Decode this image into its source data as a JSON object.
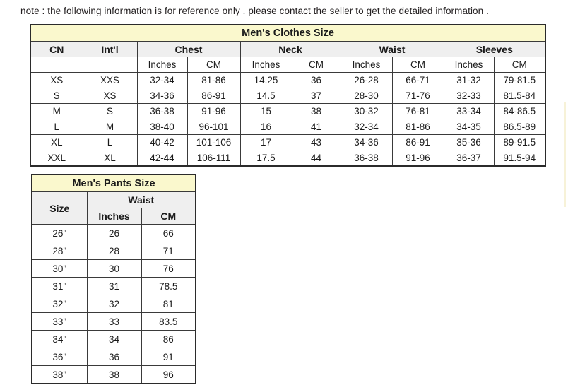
{
  "note": {
    "text": "note : the following information is for reference only . please contact the seller to get the detailed information ."
  },
  "colors": {
    "title_background": "#faf8cd",
    "header_background": "#efefef",
    "cell_background": "#ffffff",
    "border": "#3a3a3a",
    "outer_border": "#2b2b2b",
    "text": "#1b1b1b",
    "artifact_line": "#f7f2d8"
  },
  "clothes_table": {
    "title": "Men's Clothes Size",
    "group_headers": [
      "CN",
      "Int'l",
      "Chest",
      "Neck",
      "Waist",
      "Sleeves"
    ],
    "unit_headers": {
      "cn": "",
      "intl": "",
      "chest_inches": "Inches",
      "chest_cm": "CM",
      "neck_inches": "Inches",
      "neck_cm": "CM",
      "waist_inches": "Inches",
      "waist_cm": "CM",
      "sleeves_inches": "Inches",
      "sleeves_cm": "CM"
    },
    "rows": [
      {
        "cn": "XS",
        "intl": "XXS",
        "chest_inches": "32-34",
        "chest_cm": "81-86",
        "neck_inches": "14.25",
        "neck_cm": "36",
        "waist_inches": "26-28",
        "waist_cm": "66-71",
        "sleeves_inches": "31-32",
        "sleeves_cm": "79-81.5"
      },
      {
        "cn": "S",
        "intl": "XS",
        "chest_inches": "34-36",
        "chest_cm": "86-91",
        "neck_inches": "14.5",
        "neck_cm": "37",
        "waist_inches": "28-30",
        "waist_cm": "71-76",
        "sleeves_inches": "32-33",
        "sleeves_cm": "81.5-84"
      },
      {
        "cn": "M",
        "intl": "S",
        "chest_inches": "36-38",
        "chest_cm": "91-96",
        "neck_inches": "15",
        "neck_cm": "38",
        "waist_inches": "30-32",
        "waist_cm": "76-81",
        "sleeves_inches": "33-34",
        "sleeves_cm": "84-86.5"
      },
      {
        "cn": "L",
        "intl": "M",
        "chest_inches": "38-40",
        "chest_cm": "96-101",
        "neck_inches": "16",
        "neck_cm": "41",
        "waist_inches": "32-34",
        "waist_cm": "81-86",
        "sleeves_inches": "34-35",
        "sleeves_cm": "86.5-89"
      },
      {
        "cn": "XL",
        "intl": "L",
        "chest_inches": "40-42",
        "chest_cm": "101-106",
        "neck_inches": "17",
        "neck_cm": "43",
        "waist_inches": "34-36",
        "waist_cm": "86-91",
        "sleeves_inches": "35-36",
        "sleeves_cm": "89-91.5"
      },
      {
        "cn": "XXL",
        "intl": "XL",
        "chest_inches": "42-44",
        "chest_cm": "106-111",
        "neck_inches": "17.5",
        "neck_cm": "44",
        "waist_inches": "36-38",
        "waist_cm": "91-96",
        "sleeves_inches": "36-37",
        "sleeves_cm": "91.5-94"
      }
    ]
  },
  "pants_table": {
    "title": "Men's Pants Size",
    "size_header": "Size",
    "group_header": "Waist",
    "unit_headers": {
      "inches": "Inches",
      "cm": "CM"
    },
    "rows": [
      {
        "size": "26\"",
        "inches": "26",
        "cm": "66"
      },
      {
        "size": "28\"",
        "inches": "28",
        "cm": "71"
      },
      {
        "size": "30\"",
        "inches": "30",
        "cm": "76"
      },
      {
        "size": "31\"",
        "inches": "31",
        "cm": "78.5"
      },
      {
        "size": "32\"",
        "inches": "32",
        "cm": "81"
      },
      {
        "size": "33\"",
        "inches": "33",
        "cm": "83.5"
      },
      {
        "size": "34\"",
        "inches": "34",
        "cm": "86"
      },
      {
        "size": "36\"",
        "inches": "36",
        "cm": "91"
      },
      {
        "size": "38\"",
        "inches": "38",
        "cm": "96"
      }
    ]
  }
}
